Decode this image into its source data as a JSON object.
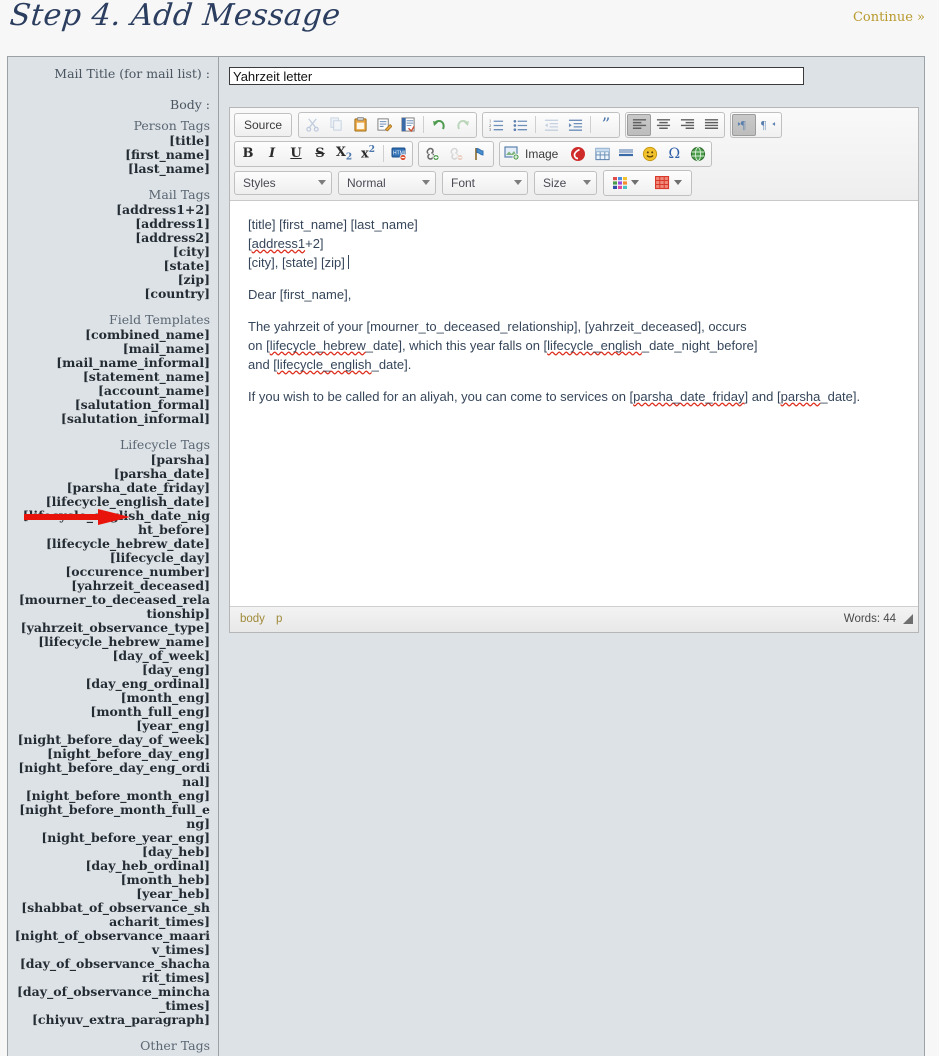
{
  "header": {
    "title": "Step 4. Add Message",
    "continue_label": "Continue »"
  },
  "form": {
    "mail_title_label": "Mail Title (for mail list) :",
    "mail_title_value": "Yahrzeit letter",
    "mail_title_placeholder": "",
    "body_label": "Body :"
  },
  "sidebar": {
    "sections": [
      {
        "heading": "Person Tags",
        "tags": [
          "[title]",
          "[first_name]",
          "[last_name]"
        ]
      },
      {
        "heading": "Mail Tags",
        "tags": [
          "[address1+2]",
          "[address1]",
          "[address2]",
          "[city]",
          "[state]",
          "[zip]",
          "[country]"
        ]
      },
      {
        "heading": "Field Templates",
        "tags": [
          "[combined_name]",
          "[mail_name]",
          "[mail_name_informal]",
          "[statement_name]",
          "[account_name]",
          "[salutation_formal]",
          "[salutation_informal]"
        ]
      },
      {
        "heading": "Lifecycle Tags",
        "tags": [
          "[parsha]",
          "[parsha_date]",
          "[parsha_date_friday]",
          "[lifecycle_english_date]",
          "[lifecycle_english_date_night_before]",
          "[lifecycle_hebrew_date]",
          "[lifecycle_day]",
          "[occurence_number]",
          "[yahrzeit_deceased]",
          "[mourner_to_deceased_relationship]",
          "[yahrzeit_observance_type]",
          "[lifecycle_hebrew_name]",
          "[day_of_week]",
          "[day_eng]",
          "[day_eng_ordinal]",
          "[month_eng]",
          "[month_full_eng]",
          "[year_eng]",
          "[night_before_day_of_week]",
          "[night_before_day_eng]",
          "[night_before_day_eng_ordinal]",
          "[night_before_month_eng]",
          "[night_before_month_full_eng]",
          "[night_before_year_eng]",
          "[day_heb]",
          "[day_heb_ordinal]",
          "[month_heb]",
          "[year_heb]",
          "[shabbat_of_observance_shacharit_times]",
          "[night_of_observance_maariv_times]",
          "[day_of_observance_shacharit_times]",
          "[day_of_observance_mincha_times]",
          "[chiyuv_extra_paragraph]"
        ]
      },
      {
        "heading": "Other Tags",
        "tags": []
      }
    ],
    "annotation": {
      "target": "Lifecycle Tags",
      "color": "#e8130a"
    }
  },
  "editor": {
    "toolbar": {
      "source_label": "Source",
      "row1_clipboard": [
        {
          "name": "cut-icon",
          "label": "✂",
          "state": "disabled"
        },
        {
          "name": "copy-icon",
          "label": "⧉",
          "state": "disabled"
        },
        {
          "name": "paste-icon",
          "label": "📋",
          "state": "normal"
        },
        {
          "name": "paste-as-plain-text-icon",
          "label": "📝",
          "state": "normal"
        },
        {
          "name": "paste-from-word-icon",
          "label": "🗎",
          "state": "normal"
        }
      ],
      "row1_history": [
        {
          "name": "undo-icon",
          "label": "↶",
          "state": "normal"
        },
        {
          "name": "redo-icon",
          "label": "↷",
          "state": "disabled"
        }
      ],
      "row1_lists": [
        {
          "name": "numbered-list-icon",
          "label": "☰",
          "state": "normal"
        },
        {
          "name": "bulleted-list-icon",
          "label": "☰",
          "state": "normal"
        },
        {
          "name": "outdent-icon",
          "label": "←",
          "state": "disabled"
        },
        {
          "name": "indent-icon",
          "label": "→",
          "state": "normal"
        },
        {
          "name": "blockquote-icon",
          "label": "”",
          "state": "normal"
        },
        {
          "name": "align-left-icon",
          "label": "≡",
          "state": "active"
        },
        {
          "name": "align-center-icon",
          "label": "≡",
          "state": "normal"
        },
        {
          "name": "align-right-icon",
          "label": "≡",
          "state": "normal"
        },
        {
          "name": "justify-icon",
          "label": "≡",
          "state": "normal"
        }
      ],
      "row1_direction": [
        {
          "name": "text-direction-ltr-icon",
          "label": "¶",
          "state": "active"
        },
        {
          "name": "text-direction-rtl-icon",
          "label": "¶",
          "state": "normal"
        }
      ],
      "row2_basic": [
        {
          "name": "bold-icon",
          "label": "B",
          "state": "normal"
        },
        {
          "name": "italic-icon",
          "label": "I",
          "state": "normal"
        },
        {
          "name": "underline-icon",
          "label": "U",
          "state": "normal"
        },
        {
          "name": "strikethrough-icon",
          "label": "S",
          "state": "normal"
        },
        {
          "name": "subscript-icon",
          "label": "X₂",
          "state": "normal"
        },
        {
          "name": "superscript-icon",
          "label": "X²",
          "state": "normal"
        },
        {
          "name": "remove-format-icon",
          "label": "HTML",
          "state": "normal"
        }
      ],
      "row2_links": [
        {
          "name": "link-icon",
          "label": "🔗",
          "state": "normal"
        },
        {
          "name": "unlink-icon",
          "label": "🔗",
          "state": "disabled"
        },
        {
          "name": "anchor-icon",
          "label": "⚑",
          "state": "normal"
        }
      ],
      "row2_insert": [
        {
          "name": "image-button",
          "label": "Image",
          "state": "normal"
        },
        {
          "name": "flash-icon",
          "label": "●",
          "state": "normal"
        },
        {
          "name": "table-icon",
          "label": "▦",
          "state": "normal"
        },
        {
          "name": "horizontal-rule-icon",
          "label": "—",
          "state": "normal"
        },
        {
          "name": "smiley-icon",
          "label": "☺",
          "state": "normal"
        },
        {
          "name": "special-character-icon",
          "label": "Ω",
          "state": "normal"
        },
        {
          "name": "page-break-icon",
          "label": "●",
          "state": "normal"
        }
      ],
      "combos": [
        {
          "name": "styles-combo",
          "label": "Styles"
        },
        {
          "name": "paragraph-format-combo",
          "label": "Normal"
        },
        {
          "name": "font-combo",
          "label": "Font"
        },
        {
          "name": "font-size-combo",
          "label": "Size"
        }
      ],
      "color_buttons": [
        {
          "name": "text-color-button",
          "label": ""
        },
        {
          "name": "background-color-button",
          "label": ""
        }
      ]
    },
    "content": {
      "paragraphs": [
        {
          "lines": [
            [
              {
                "t": "[title] [first_name] [last_name]",
                "spell": false
              }
            ],
            [
              {
                "t": "[",
                "spell": false
              },
              {
                "t": "address1",
                "spell": true
              },
              {
                "t": "+2]",
                "spell": false
              }
            ],
            [
              {
                "t": "[city], [state] [zip]",
                "spell": false,
                "caret": true
              }
            ]
          ]
        },
        {
          "lines": [
            [
              {
                "t": "Dear [first_name],",
                "spell": false
              }
            ]
          ]
        },
        {
          "lines": [
            [
              {
                "t": "The yahrzeit of your [mourner_to_deceased_relationship], [yahrzeit_deceased], occurs",
                "spell": false
              }
            ],
            [
              {
                "t": "on [",
                "spell": false
              },
              {
                "t": "lifecycle_hebrew",
                "spell": true
              },
              {
                "t": "_date], which this year falls on [",
                "spell": false
              },
              {
                "t": "lifecycle_english",
                "spell": true
              },
              {
                "t": "_date_night_before]",
                "spell": false
              }
            ],
            [
              {
                "t": "and [",
                "spell": false
              },
              {
                "t": "lifecycle_english",
                "spell": true
              },
              {
                "t": "_date].",
                "spell": false
              }
            ]
          ]
        },
        {
          "lines": [
            [
              {
                "t": "If you wish to be called for an aliyah, you can come to services on [",
                "spell": false
              },
              {
                "t": "parsha_date_friday",
                "spell": true
              },
              {
                "t": "] and [",
                "spell": false
              },
              {
                "t": "parsha",
                "spell": true
              },
              {
                "t": "_date].",
                "spell": false
              }
            ]
          ]
        }
      ]
    },
    "status": {
      "elements_path": [
        "body",
        "p"
      ],
      "word_count": "Words: 44"
    }
  },
  "colors": {
    "panel_bg": "#dde2e6",
    "panel_border": "#9aa1a7",
    "page_bg": "#f7f7f7",
    "title_text": "#2c3e60",
    "continue_text": "#b89a2e",
    "editor_text": "#36465a",
    "path_text": "#a08a3a",
    "spellcheck_underline": "#dd3322",
    "annotation_red": "#e8130a"
  }
}
